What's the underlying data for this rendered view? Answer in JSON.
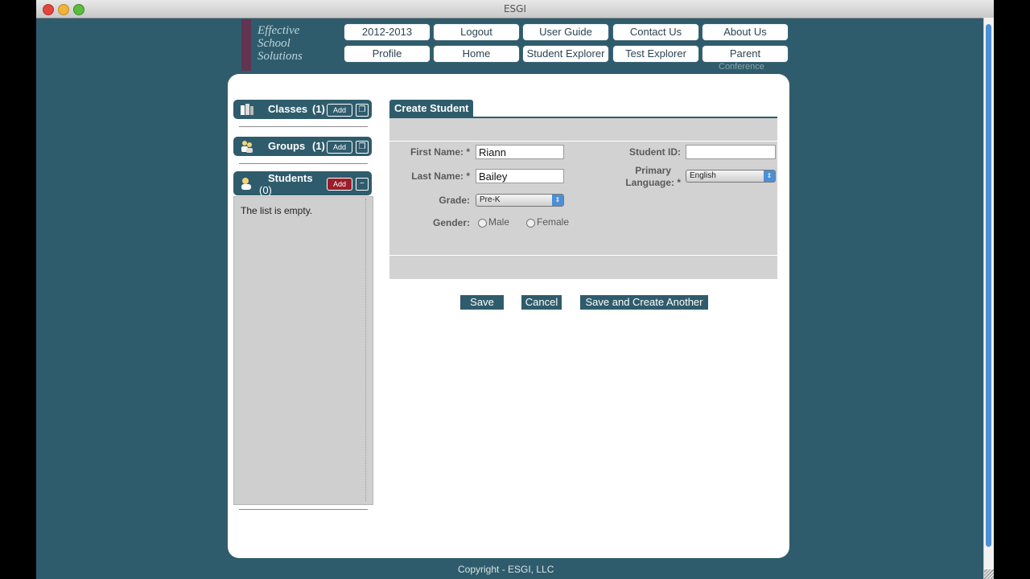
{
  "window": {
    "title": "ESGI"
  },
  "logo": {
    "text": "Effective School Solutions"
  },
  "nav": {
    "row1": [
      "2012-2013",
      "Logout",
      "User Guide",
      "Contact Us",
      "About Us"
    ],
    "row2": [
      "Profile",
      "Home",
      "Student Explorer",
      "Test Explorer",
      "Parent"
    ],
    "parent_sub": "Conference"
  },
  "sidebar": {
    "classes": {
      "label": "Classes",
      "count": "(1)",
      "add": "Add"
    },
    "groups": {
      "label": "Groups",
      "count": "(1)",
      "add": "Add"
    },
    "students": {
      "label": "Students",
      "count": "(0)",
      "add": "Add"
    },
    "empty_text": "The list is empty."
  },
  "form": {
    "title": "Create Student",
    "first_name_label": "First Name: *",
    "first_name_value": "Riann",
    "last_name_label": "Last Name: *",
    "last_name_value": "Bailey",
    "grade_label": "Grade:",
    "grade_value": "Pre-K",
    "gender_label": "Gender:",
    "gender_male": "Male",
    "gender_female": "Female",
    "student_id_label": "Student ID:",
    "student_id_value": "",
    "primary_language_label_1": "Primary",
    "primary_language_label_2": "Language: *",
    "primary_language_value": "English"
  },
  "actions": {
    "save": "Save",
    "cancel": "Cancel",
    "save_another": "Save and Create Another"
  },
  "footer": {
    "copyright": "Copyright - ESGI, LLC"
  }
}
